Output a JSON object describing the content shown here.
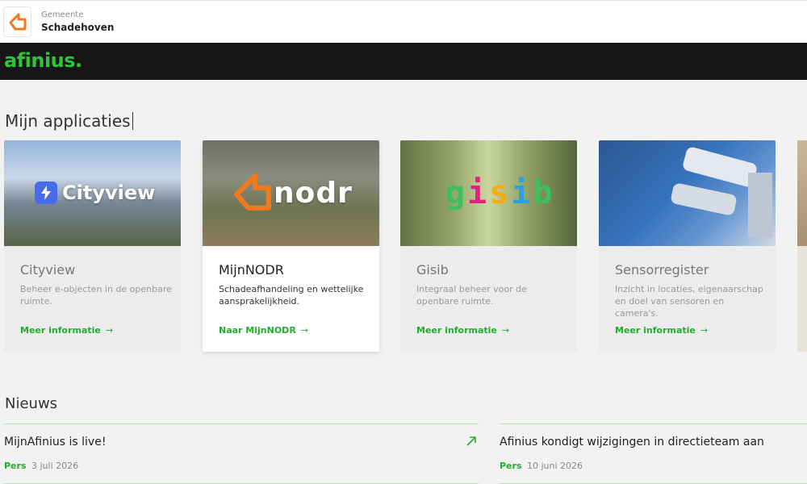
{
  "header": {
    "municipality_label": "Gemeente",
    "municipality_name": "Schadehoven",
    "logo_icon": "orange-arrow-logo-icon",
    "brand": "afinius."
  },
  "apps": {
    "title": "Mijn applicaties",
    "cards": [
      {
        "logo": "Cityview",
        "title": "Cityview",
        "description": "Beheer e-objecten in de openbare ruimte.",
        "link": "Meer informatie"
      },
      {
        "logo": "nodr",
        "title": "MijnNODR",
        "description": "Schadeafhandeling en wettelijke aansprakelijkheid.",
        "link": "Naar MijnNODR"
      },
      {
        "logo": "gisib",
        "title": "Gisib",
        "description": "Integraal beheer voor de openbare ruimte.",
        "link": "Meer informatie"
      },
      {
        "logo": "",
        "title": "Sensorregister",
        "description": "Inzicht in locaties, eigenaarschap en doel van sensoren en camera's.",
        "link": "Meer informatie"
      }
    ]
  },
  "news": {
    "title": "Nieuws",
    "items": [
      {
        "headline": "MijnAfinius is live!",
        "tag": "Pers",
        "date": "3 juli 2026"
      },
      {
        "headline": "Afinius kondigt wijzigingen in directieteam aan",
        "tag": "Pers",
        "date": "10 juni 2026"
      }
    ]
  },
  "colors": {
    "brand_green": "#2fc43a",
    "link_green": "#1fae2e",
    "brand_bar": "#161616",
    "nodr_orange": "#f07b1c",
    "cityview_blue": "#3b63e8"
  }
}
